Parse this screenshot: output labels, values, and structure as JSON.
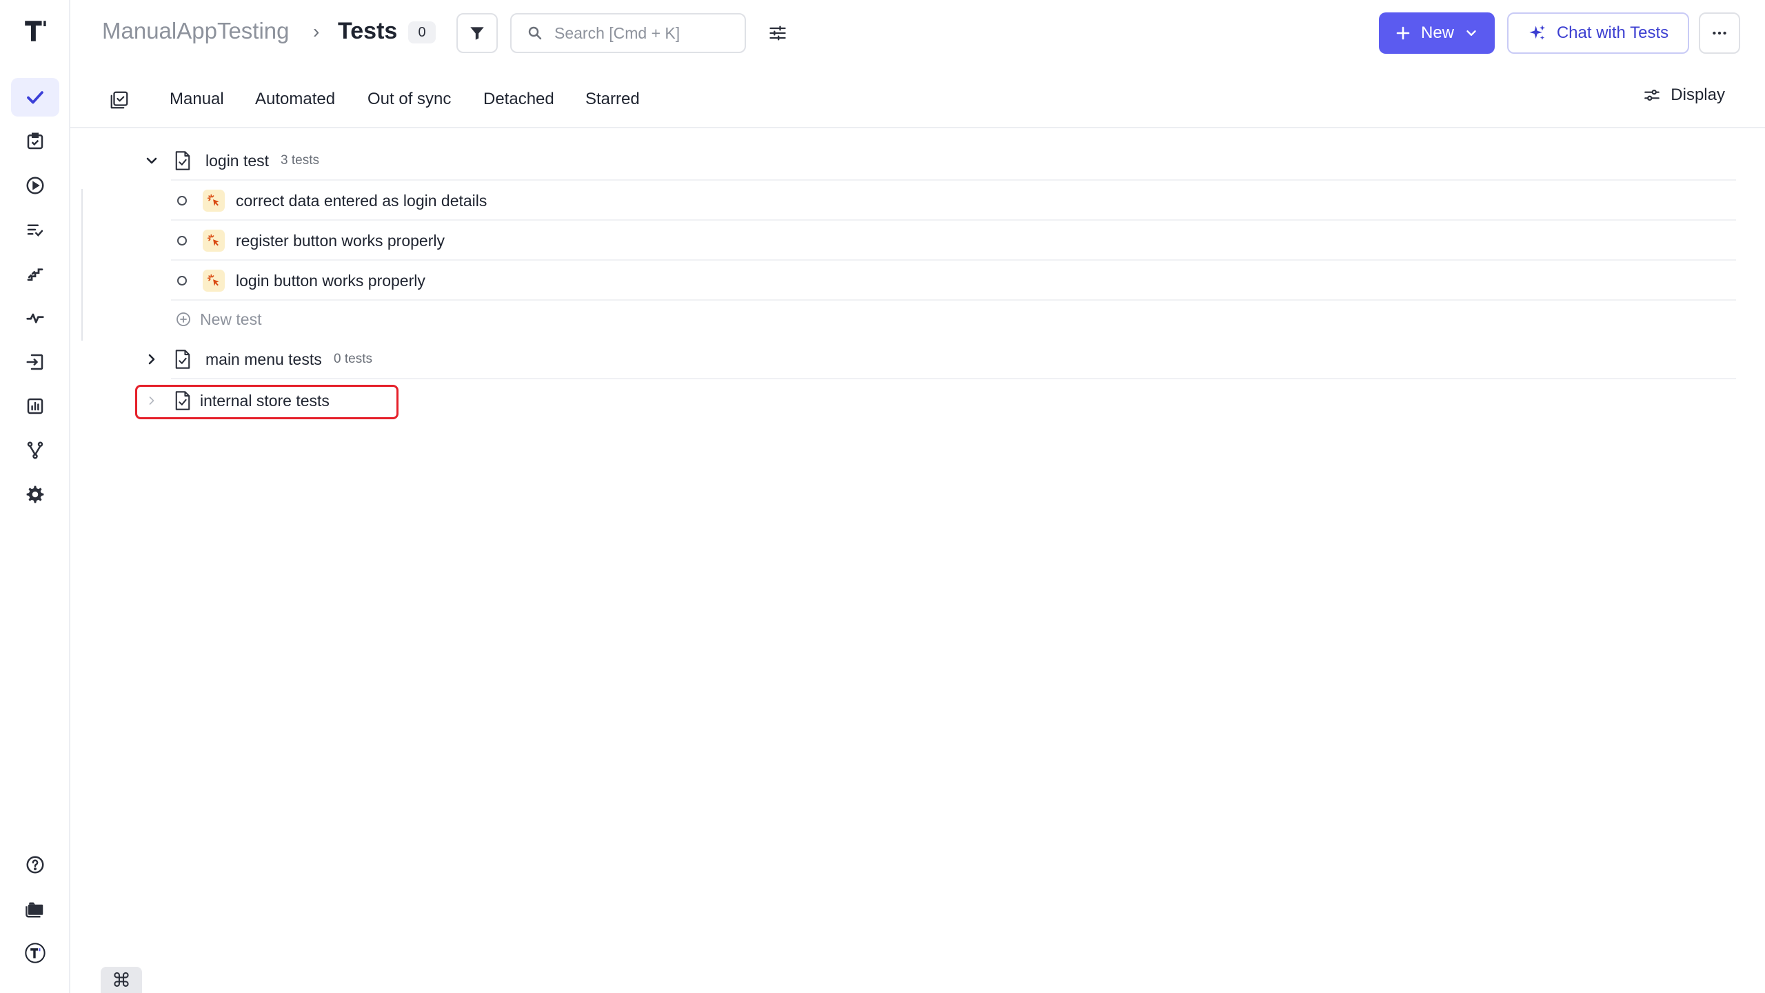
{
  "breadcrumb": {
    "project": "ManualAppTesting",
    "separator": "›",
    "current": "Tests",
    "count": "0"
  },
  "search": {
    "placeholder": "Search [Cmd + K]"
  },
  "actions": {
    "new_label": "New",
    "chat_label": "Chat with Tests"
  },
  "tabs": [
    {
      "label": "Manual"
    },
    {
      "label": "Automated"
    },
    {
      "label": "Out of sync"
    },
    {
      "label": "Detached"
    },
    {
      "label": "Starred"
    }
  ],
  "display_label": "Display",
  "suites": [
    {
      "name": "login test",
      "count": "3 tests",
      "expanded": true,
      "tests": [
        {
          "name": "correct data entered as login details"
        },
        {
          "name": "register button works properly"
        },
        {
          "name": "login button works properly"
        }
      ],
      "new_test_label": "New test"
    },
    {
      "name": "main menu tests",
      "count": "0 tests",
      "expanded": false
    },
    {
      "name": "internal store tests",
      "count": "",
      "expanded": false
    }
  ],
  "bottom": {
    "cmd_symbol": "⌘"
  },
  "colors": {
    "accent": "#5b5bf0",
    "highlight": "#e5202a",
    "manual_badge": "#fcefc9"
  },
  "icons": {
    "sidebar": [
      "tests-check-icon",
      "runs-clipboard-icon",
      "play-circle-icon",
      "checklist-icon",
      "steps-icon",
      "pulse-icon",
      "import-icon",
      "analytics-icon",
      "branches-icon",
      "settings-gear-icon",
      "help-icon",
      "folder-icon",
      "profile-logo-icon"
    ]
  }
}
